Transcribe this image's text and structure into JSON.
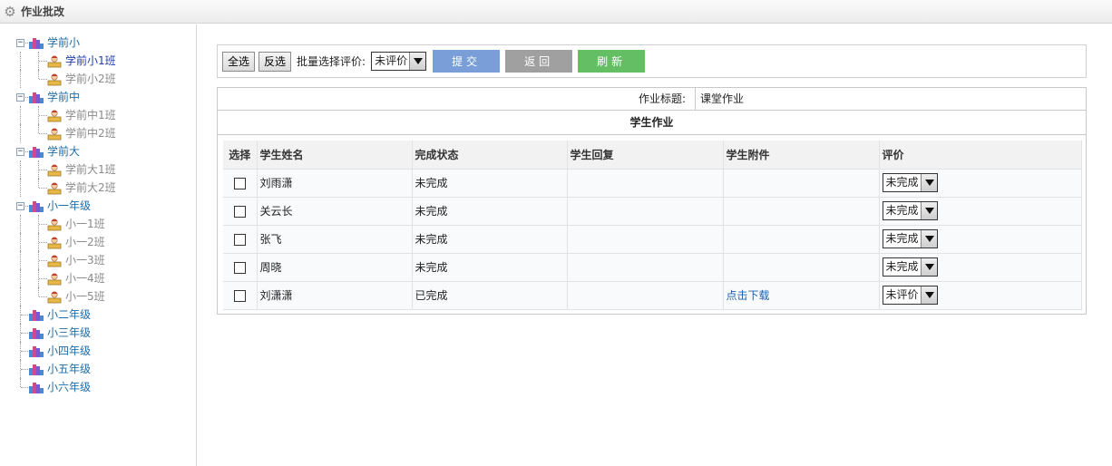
{
  "header": {
    "title": "作业批改",
    "icon": "gear-icon"
  },
  "tree": {
    "groups": [
      {
        "label": "学前小",
        "classes": [
          "学前小1班",
          "学前小2班"
        ]
      },
      {
        "label": "学前中",
        "classes": [
          "学前中1班",
          "学前中2班"
        ]
      },
      {
        "label": "学前大",
        "classes": [
          "学前大1班",
          "学前大2班"
        ]
      },
      {
        "label": "小一年级",
        "classes": [
          "小一1班",
          "小一2班",
          "小一3班",
          "小一4班",
          "小一5班"
        ]
      },
      {
        "label": "小二年级",
        "classes": []
      },
      {
        "label": "小三年级",
        "classes": []
      },
      {
        "label": "小四年级",
        "classes": []
      },
      {
        "label": "小五年级",
        "classes": []
      },
      {
        "label": "小六年级",
        "classes": []
      }
    ],
    "active": "学前小1班",
    "expand_symbol": "−"
  },
  "toolbar": {
    "select_all": "全选",
    "invert": "反选",
    "batch_label": "批量选择评价:",
    "batch_value": "未评价",
    "submit": "提交",
    "back": "返回",
    "refresh": "刷新"
  },
  "homework": {
    "title_label": "作业标题:",
    "title_value": "课堂作业",
    "section": "学生作业"
  },
  "grid": {
    "columns": [
      "选择",
      "学生姓名",
      "完成状态",
      "学生回复",
      "学生附件",
      "评价"
    ],
    "rows": [
      {
        "name": "刘雨潇",
        "status": "未完成",
        "reply": "",
        "attachment": "",
        "eval": "未完成"
      },
      {
        "name": "关云长",
        "status": "未完成",
        "reply": "",
        "attachment": "",
        "eval": "未完成"
      },
      {
        "name": "张飞",
        "status": "未完成",
        "reply": "",
        "attachment": "",
        "eval": "未完成"
      },
      {
        "name": "周晓",
        "status": "未完成",
        "reply": "",
        "attachment": "",
        "eval": "未完成"
      },
      {
        "name": "刘潇潇",
        "status": "已完成",
        "reply": "",
        "attachment": "点击下载",
        "eval": "未评价"
      }
    ]
  },
  "colors": {
    "group_label": "#1f6ca8",
    "class_label": "#8a8a8a",
    "active_label": "#1f3fa8",
    "submit_button": "#7a9fd8",
    "back_button": "#a0a0a0",
    "refresh_button": "#64be64",
    "link": "#1f5fa8"
  }
}
